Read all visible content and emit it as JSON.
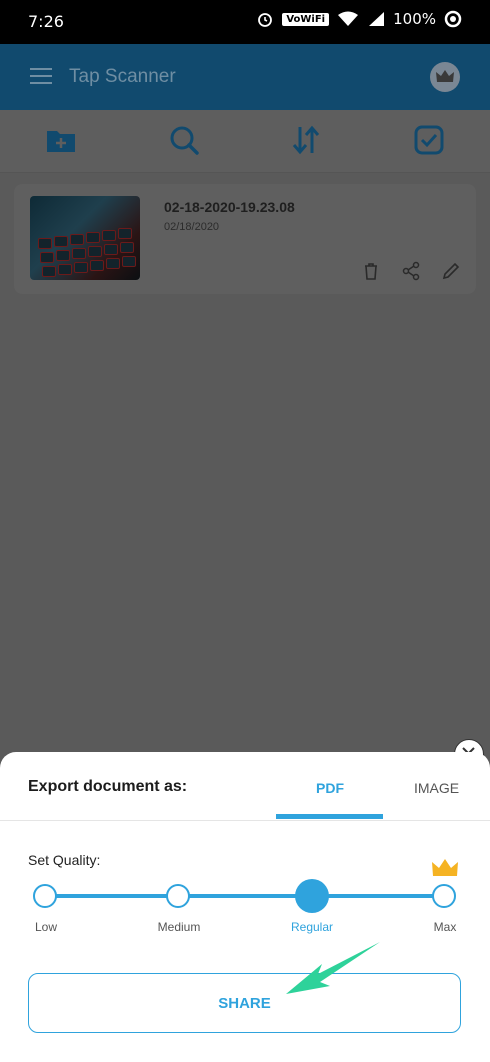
{
  "status_bar": {
    "time": "7:26",
    "network_label": "VoWiFi",
    "battery": "100%"
  },
  "app_bar": {
    "title": "Tap Scanner"
  },
  "toolbar": {
    "icons": [
      "new-folder-icon",
      "search-icon",
      "sort-icon",
      "select-icon"
    ]
  },
  "document": {
    "name": "02-18-2020-19.23.08",
    "date": "02/18/2020"
  },
  "export_sheet": {
    "heading": "Export document as:",
    "tabs": [
      {
        "label": "PDF",
        "selected": true
      },
      {
        "label": "IMAGE",
        "selected": false
      }
    ],
    "quality_label": "Set Quality:",
    "quality_levels": [
      "Low",
      "Medium",
      "Regular",
      "Max"
    ],
    "selected_quality": "Regular",
    "share_label": "SHARE"
  },
  "colors": {
    "accent": "#2fa3dd",
    "app_bar": "#114a6e",
    "arrow": "#2ed29a",
    "crown": "#f5b323"
  }
}
